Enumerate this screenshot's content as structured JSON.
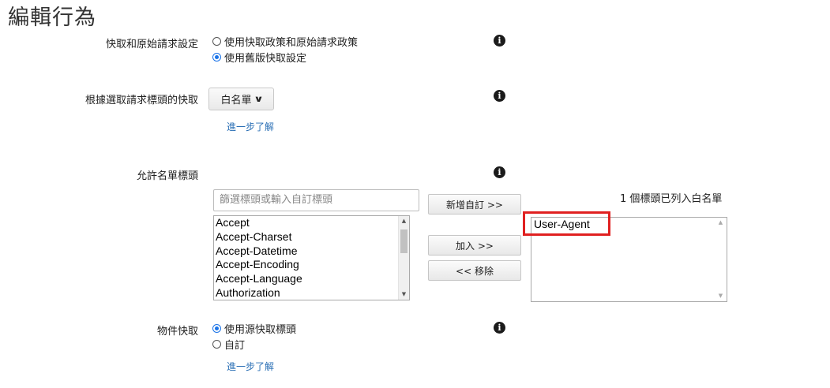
{
  "page": {
    "title": "編輯行為"
  },
  "cache_settings": {
    "label": "快取和原始請求設定",
    "options": [
      "使用快取政策和原始請求政策",
      "使用舊版快取設定"
    ],
    "selected_index": 1
  },
  "header_cache": {
    "label": "根據選取請求標頭的快取",
    "dropdown_value": "白名單",
    "learn_more": "進一步了解"
  },
  "allowlist_headers": {
    "label": "允許名單標頭",
    "filter_placeholder": "篩選標頭或輸入自訂標頭",
    "available": [
      "Accept",
      "Accept-Charset",
      "Accept-Datetime",
      "Accept-Encoding",
      "Accept-Language",
      "Authorization"
    ],
    "buttons": {
      "add_custom": "新增自訂 >>",
      "add": "加入 >>",
      "remove": "<< 移除"
    },
    "count_text": "1 個標頭已列入白名單",
    "selected": [
      "User-Agent"
    ]
  },
  "object_caching": {
    "label": "物件快取",
    "options": [
      "使用源快取標頭",
      "自訂"
    ],
    "selected_index": 0,
    "learn_more": "進一步了解"
  },
  "icons": {
    "info": "info-icon",
    "dropdown": "chevron-down-icon"
  },
  "colors": {
    "link": "#2a6fb5",
    "highlight": "#e02020",
    "radio_checked": "#1a73e8"
  }
}
